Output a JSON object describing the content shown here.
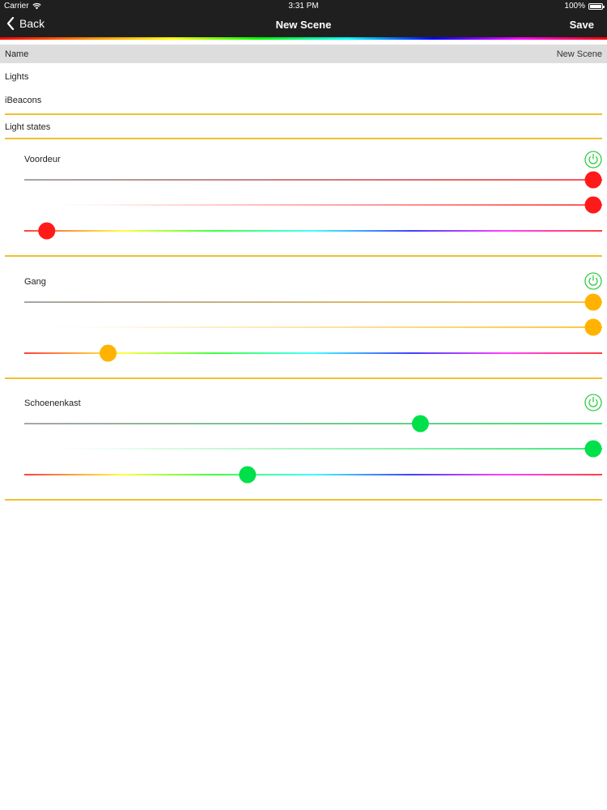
{
  "status_bar": {
    "carrier": "Carrier",
    "time": "3:31 PM",
    "battery": "100%",
    "wifi_icon": "wifi-icon",
    "battery_icon": "battery-icon"
  },
  "nav": {
    "back_label": "Back",
    "back_icon": "chevron-left-icon",
    "title": "New Scene",
    "save_label": "Save"
  },
  "form": {
    "name_label": "Name",
    "name_value": "New Scene",
    "lights_label": "Lights",
    "ibeacons_label": "iBeacons",
    "light_states_label": "Light states"
  },
  "colors": {
    "separator": "#f0c030",
    "header_bg": "#1f1f1f",
    "name_row_bg": "#dddddd"
  },
  "light_states": [
    {
      "name": "Voordeur",
      "color": "#ff1a1a",
      "power_icon": "power-icon",
      "brightness": 1.0,
      "saturation": 1.0,
      "hue": 0.02
    },
    {
      "name": "Gang",
      "color": "#ffb300",
      "power_icon": "power-icon",
      "brightness": 1.0,
      "saturation": 1.0,
      "hue": 0.13
    },
    {
      "name": "Schoenenkast",
      "color": "#00e04a",
      "power_icon": "power-icon",
      "brightness": 0.69,
      "saturation": 1.0,
      "hue": 0.38
    }
  ]
}
